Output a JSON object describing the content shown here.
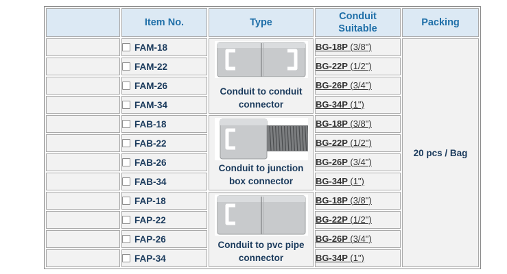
{
  "headers": {
    "blank": "",
    "item_no": "Item No.",
    "type": "Type",
    "conduit_line1": "Conduit",
    "conduit_line2": "Suitable",
    "packing": "Packing"
  },
  "groups": [
    {
      "type_line1": "Conduit to conduit",
      "type_line2": "connector",
      "image_icon": "conduit-to-conduit-connector-icon",
      "rows": [
        {
          "item": "FAM-18",
          "conduit_code": "BG-18P",
          "conduit_size": "(3/8\")"
        },
        {
          "item": "FAM-22",
          "conduit_code": "BG-22P",
          "conduit_size": "(1/2\")"
        },
        {
          "item": "FAM-26",
          "conduit_code": "BG-26P",
          "conduit_size": "(3/4\")"
        },
        {
          "item": "FAM-34",
          "conduit_code": "BG-34P",
          "conduit_size": "(1\")"
        }
      ]
    },
    {
      "type_line1": "Conduit to junction",
      "type_line2": "box connector",
      "image_icon": "conduit-to-junction-box-connector-icon",
      "rows": [
        {
          "item": "FAB-18",
          "conduit_code": "BG-18P",
          "conduit_size": "(3/8\")"
        },
        {
          "item": "FAB-22",
          "conduit_code": "BG-22P",
          "conduit_size": "(1/2\")"
        },
        {
          "item": "FAB-26",
          "conduit_code": "BG-26P",
          "conduit_size": "(3/4\")"
        },
        {
          "item": "FAB-34",
          "conduit_code": "BG-34P",
          "conduit_size": "(1\")"
        }
      ]
    },
    {
      "type_line1": "Conduit to pvc pipe",
      "type_line2": "connector",
      "image_icon": "conduit-to-pvc-pipe-connector-icon",
      "rows": [
        {
          "item": "FAP-18",
          "conduit_code": "BG-18P",
          "conduit_size": "(3/8\")"
        },
        {
          "item": "FAP-22",
          "conduit_code": "BG-22P",
          "conduit_size": "(1/2\")"
        },
        {
          "item": "FAP-26",
          "conduit_code": "BG-26P",
          "conduit_size": "(3/4\")"
        },
        {
          "item": "FAP-34",
          "conduit_code": "BG-34P",
          "conduit_size": "(1\")"
        }
      ]
    }
  ],
  "packing": "20 pcs / Bag",
  "colors": {
    "header_bg": "#dce9f4",
    "header_text": "#1f6fa8",
    "cell_bg": "#f2f2f2",
    "body_text": "#1a3a5c",
    "border": "#a9a9a9"
  }
}
